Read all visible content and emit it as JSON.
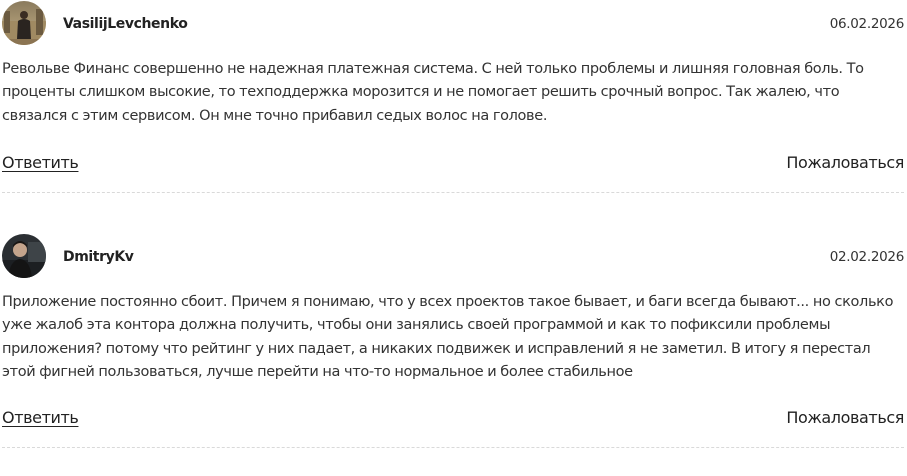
{
  "reviews": [
    {
      "author": "VasilijLevchenko",
      "date": "06.02.2026",
      "text": "Револьве Финанс совершенно не надежная платежная система. С ней только проблемы и лишняя головная боль. То проценты слишком высокие, то техподдержка морозится и не помогает решить срочный вопрос. Так жалею, что связался с этим сервисом. Он мне точно прибавил седых волос на голове.",
      "reply_label": "Ответить",
      "complain_label": "Пожаловаться",
      "avatar_icon": "user-photo-avatar"
    },
    {
      "author": "DmitryKv",
      "date": "02.02.2026",
      "text": "Приложение постоянно сбоит. Причем я понимаю, что у всех проектов такое бывает, и баги всегда бывают... но сколько уже жалоб эта контора должна получить, чтобы они занялись своей программой и как то пофиксили проблемы приложения? потому что рейтинг у них падает, а никаких подвижек и исправлений я не заметил. В итогу я перестал этой фигней пользоваться, лучше перейти на что-то нормальное и более стабильное",
      "reply_label": "Ответить",
      "complain_label": "Пожаловаться",
      "avatar_icon": "user-photo-avatar"
    }
  ],
  "colors": {
    "text": "#333333",
    "divider": "#d9d9d9"
  }
}
